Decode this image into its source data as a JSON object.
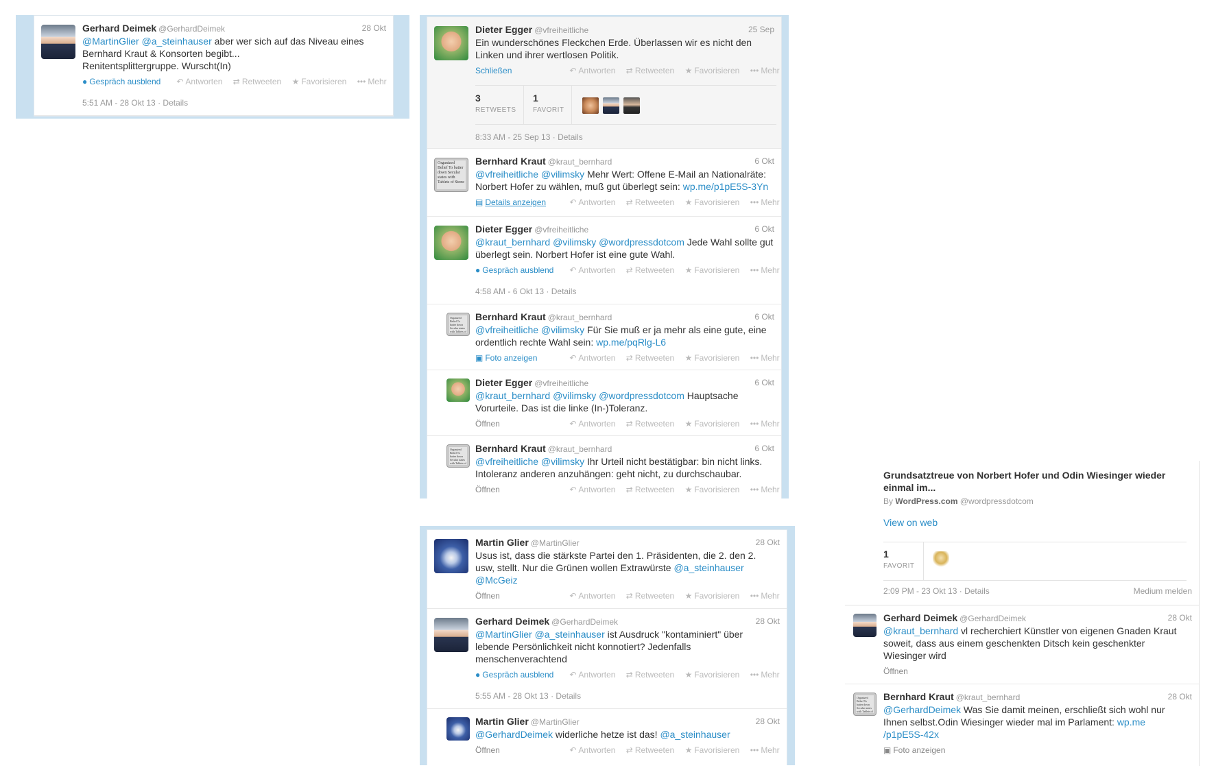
{
  "actions": {
    "reply": "Antworten",
    "retweet": "Retweeten",
    "favorite": "Favorisieren",
    "more": "Mehr",
    "hide_conversation": "Gespräch ausblend",
    "open": "Öffnen",
    "close": "Schließen",
    "show_details": "Details anzeigen",
    "show_photo": "Foto anzeigen",
    "details": "Details"
  },
  "users": {
    "gerhard": {
      "name": "Gerhard Deimek",
      "handle": "@GerhardDeimek"
    },
    "dieter": {
      "name": "Dieter Egger",
      "handle": "@vfreiheitliche"
    },
    "bernhard": {
      "name": "Bernhard Kraut",
      "handle": "@kraut_bernhard"
    },
    "martin": {
      "name": "Martin Glier",
      "handle": "@MartinGlier"
    }
  },
  "avatar_text": "Organized Belief To batter down Secular states with Tablets of Stone",
  "panel1": {
    "t1": {
      "date": "28 Okt",
      "text_html": "<a>@MartinGlier</a> <a>@a_steinhauser</a> aber wer sich auf das Niveau eines Bernhard Kraut &amp; Konsorten begibt...<br>Renitentsplittergruppe. Wurscht(In)",
      "timestamp": "5:51 AM - 28 Okt 13"
    }
  },
  "panel2": {
    "t1": {
      "date": "25 Sep",
      "text_html": "Ein wunderschönes Fleckchen Erde. Überlassen wir es nicht den Linken und ihrer wertlosen Politik.",
      "retweets": "3",
      "retweets_label": "RETWEETS",
      "favorites": "1",
      "favorites_label": "FAVORIT",
      "timestamp": "8:33 AM - 25 Sep 13"
    },
    "t2": {
      "date": "6 Okt",
      "text_html": "<a>@vfreiheitliche</a> <a>@vilimsky</a> Mehr Wert: Offene E-Mail an Nationalräte: Norbert Hofer zu wählen, muß gut überlegt sein: <a>wp.me/p1pE5S-3Yn</a>"
    },
    "t3": {
      "date": "6 Okt",
      "text_html": "<a>@kraut_bernhard</a> <a>@vilimsky</a> <a>@wordpressdotcom</a> Jede Wahl sollte gut überlegt sein. Norbert Hofer ist eine gute Wahl.",
      "timestamp": "4:58 AM - 6 Okt 13"
    },
    "t4": {
      "date": "6 Okt",
      "text_html": "<a>@vfreiheitliche</a> <a>@vilimsky</a> Für Sie muß er ja mehr als eine gute, eine ordentlich rechte Wahl sein: <a>wp.me/pqRlg-L6</a>"
    },
    "t5": {
      "date": "6 Okt",
      "text_html": "<a>@kraut_bernhard</a> <a>@vilimsky</a> <a>@wordpressdotcom</a> Hauptsache Vorurteile. Das ist die linke (In-)Toleranz."
    },
    "t6": {
      "date": "6 Okt",
      "text_html": "<a>@vfreiheitliche</a> <a>@vilimsky</a> Ihr Urteil nicht bestätigbar: bin nicht links. Intoleranz anderen anzuhängen: geht nicht, zu durchschaubar."
    }
  },
  "panel3": {
    "t1": {
      "date": "28 Okt",
      "text_html": "Usus ist, dass die stärkste Partei den 1. Präsidenten, die 2. den 2. usw, stellt. Nur die Grünen wollen Extrawürste <a>@a_steinhauser</a> <a>@McGeiz</a>"
    },
    "t2": {
      "date": "28 Okt",
      "text_html": "<a>@MartinGlier</a> <a>@a_steinhauser</a> ist Ausdruck \"kontaminiert\" über lebende Persönlichkeit nicht konnotiert? Jedenfalls menschenverachtend",
      "timestamp": "5:55 AM - 28 Okt 13"
    },
    "t3": {
      "date": "28 Okt",
      "text_html": "<a>@GerhardDeimek</a> widerliche hetze ist das! <a>@a_steinhauser</a>"
    }
  },
  "panel4": {
    "card_title": "Grundsatztreue von Norbert Hofer und Odin Wiesinger wieder einmal im...",
    "card_by_prefix": "By",
    "card_source": "WordPress.com",
    "card_handle": "@wordpressdotcom",
    "view_on_web": "View on web",
    "favorites": "1",
    "favorites_label": "FAVORIT",
    "timestamp": "2:09 PM - 23 Okt 13",
    "report": "Medium melden",
    "t1": {
      "date": "28 Okt",
      "text_html": "<a>@kraut_bernhard</a> vl recherchiert Künstler von eigenen Gnaden Kraut soweit, dass aus einem geschenkten Ditsch kein geschenkter Wiesinger wird"
    },
    "t2": {
      "date": "28 Okt",
      "text_html": "<a>@GerhardDeimek</a> Was Sie damit meinen, erschließt sich wohl nur Ihnen selbst.Odin Wiesinger wieder mal im Parlament: <a>wp.me /p1pE5S-42x</a>"
    }
  }
}
